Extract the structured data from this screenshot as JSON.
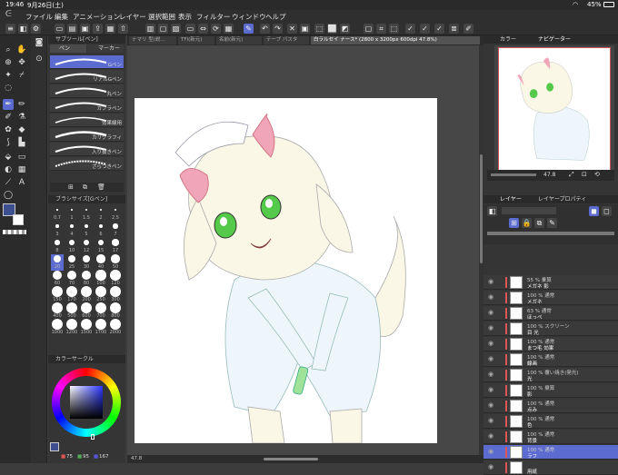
{
  "status": {
    "time": "19:46",
    "date": "9月26日(土)",
    "battery": "45%"
  },
  "menu": [
    "ファイル",
    "編集",
    "アニメーション",
    "レイヤー",
    "選択範囲",
    "表示",
    "フィルター",
    "ウィンドウ",
    "ヘルプ"
  ],
  "tabs": [
    {
      "label": "ナマリ 型(説…",
      "active": false
    },
    {
      "label": "TFI(新元)",
      "active": false
    },
    {
      "label": "名前(新元)",
      "active": false
    },
    {
      "label": "テープ パスタ",
      "active": false
    },
    {
      "label": "白ラルセイ ナース* (2800 x 3200px 600dpi 47.8%)",
      "active": true
    }
  ],
  "brush_panel": {
    "header": "サブツール[ペン]",
    "tab_pen": "ペン",
    "tab_marker": "マーカー",
    "brushes": [
      "Gペン",
      "リアルGペン",
      "丸ペン",
      "カブラペン",
      "効果線用",
      "カリグラフィ",
      "入り抜きペン",
      "ざらつきペン"
    ],
    "size_header": "ブラシサイズ[Gペン]",
    "sizes": [
      "0.7",
      "1",
      "1.5",
      "2",
      "2.5",
      "3",
      "4",
      "5",
      "6",
      "7",
      "8",
      "10",
      "12",
      "15",
      "17",
      "20",
      "25",
      "30",
      "40",
      "50",
      "60",
      "70",
      "80",
      "100",
      "120",
      "150",
      "170",
      "200",
      "250",
      "300",
      "400",
      "500",
      "600",
      "700",
      "800",
      "1000",
      "1200",
      "1500",
      "1700",
      "2000"
    ],
    "color_header": "カラーサークル",
    "hsv": {
      "h": "75",
      "s": "95",
      "v": "167"
    }
  },
  "navigator": {
    "tab1": "カラー",
    "tab2": "ナビゲーター",
    "zoom": "47.8"
  },
  "layer_panel": {
    "tab1": "レイヤー",
    "tab2": "レイヤープロパティ",
    "layers": [
      {
        "mode": "55 % 乗算",
        "name": "メガネ 影",
        "selected": false
      },
      {
        "mode": "100 % 通常",
        "name": "メガネ",
        "selected": false
      },
      {
        "mode": "63 % 通常",
        "name": "ほっぺ",
        "selected": false
      },
      {
        "mode": "100 % スクリーン",
        "name": "目 光",
        "selected": false
      },
      {
        "mode": "100 % 通常",
        "name": "まつ毛 効果",
        "selected": false
      },
      {
        "mode": "100 % 通常",
        "name": "線画",
        "selected": false
      },
      {
        "mode": "100 % 覆い焼き(発光)",
        "name": "光",
        "selected": false
      },
      {
        "mode": "100 % 乗算",
        "name": "影",
        "selected": false
      },
      {
        "mode": "100 % 通常",
        "name": "点み",
        "selected": false
      },
      {
        "mode": "100 % 通常",
        "name": "色",
        "selected": false
      },
      {
        "mode": "100 % 通常",
        "name": "背景",
        "selected": false
      },
      {
        "mode": "100 % 通常",
        "name": "ラフ",
        "selected": true
      },
      {
        "mode": "",
        "name": "用紙",
        "selected": false
      }
    ]
  },
  "bottom": {
    "zoom": "47.8"
  },
  "colors": {
    "accent": "#5b6bd0",
    "main_color": "#3d4f8f"
  }
}
